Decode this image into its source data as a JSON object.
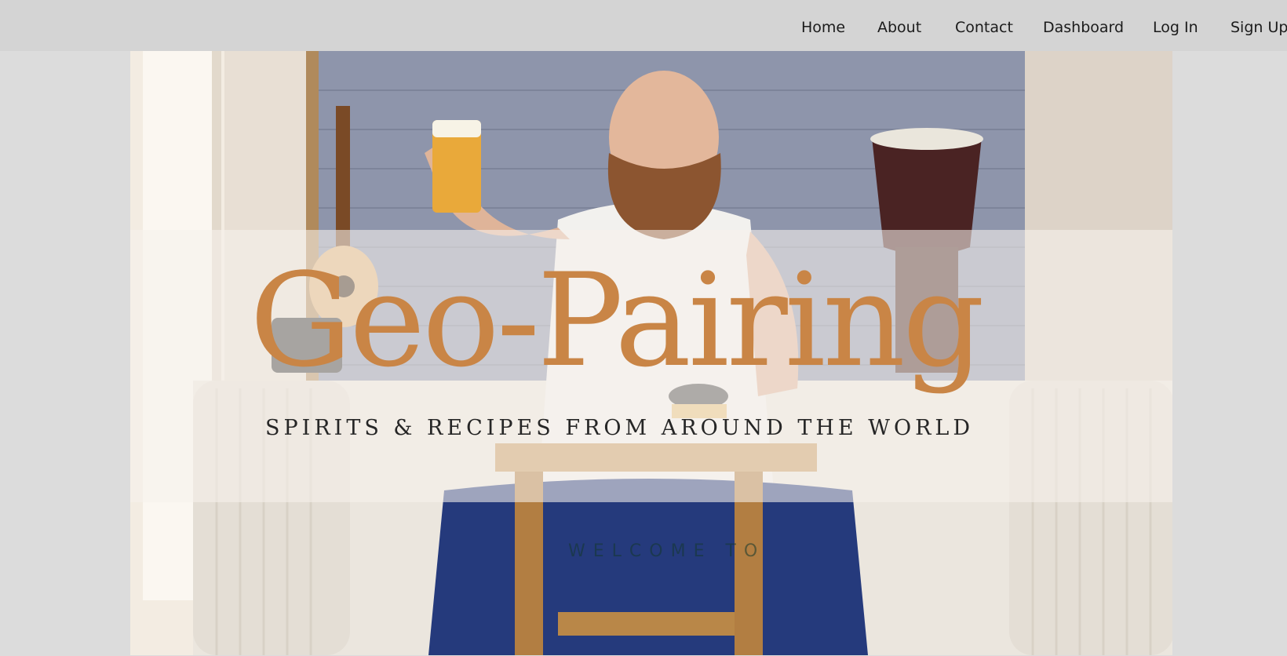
{
  "nav": {
    "items": [
      {
        "label": "Home"
      },
      {
        "label": "About"
      },
      {
        "label": "Contact"
      },
      {
        "label": "Dashboard"
      },
      {
        "label": "Log In"
      },
      {
        "label": "Sign Up"
      }
    ]
  },
  "hero": {
    "title": "Geo-Pairing",
    "tagline": "SPIRITS & RECIPES FROM AROUND THE WORLD",
    "welcome": "WELCOME TO"
  },
  "colors": {
    "navbar_bg": "#d4d4d4",
    "page_bg": "#dcdcdc",
    "title_accent": "#c98546",
    "tagline": "#262626",
    "welcome": "#14382d"
  }
}
